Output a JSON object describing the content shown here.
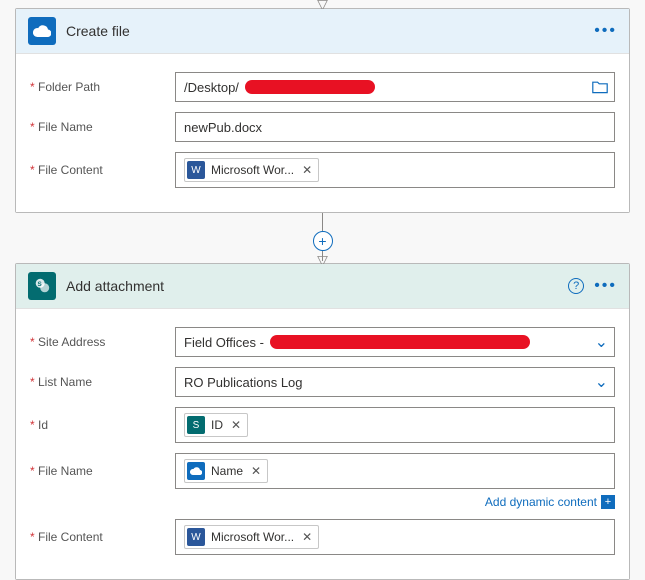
{
  "create_file": {
    "title": "Create file",
    "folder_path_label": "Folder Path",
    "folder_path_value": "/Desktop/",
    "file_name_label": "File Name",
    "file_name_value": "newPub.docx",
    "file_content_label": "File Content",
    "file_content_token": "Microsoft Wor..."
  },
  "add_attachment": {
    "title": "Add attachment",
    "site_address_label": "Site Address",
    "site_address_value": "Field Offices - ",
    "list_name_label": "List Name",
    "list_name_value": "RO Publications Log",
    "id_label": "Id",
    "id_token": "ID",
    "file_name_label": "File Name",
    "file_name_token": "Name",
    "file_content_label": "File Content",
    "file_content_token": "Microsoft Wor...",
    "dynamic_content_label": "Add dynamic content"
  }
}
